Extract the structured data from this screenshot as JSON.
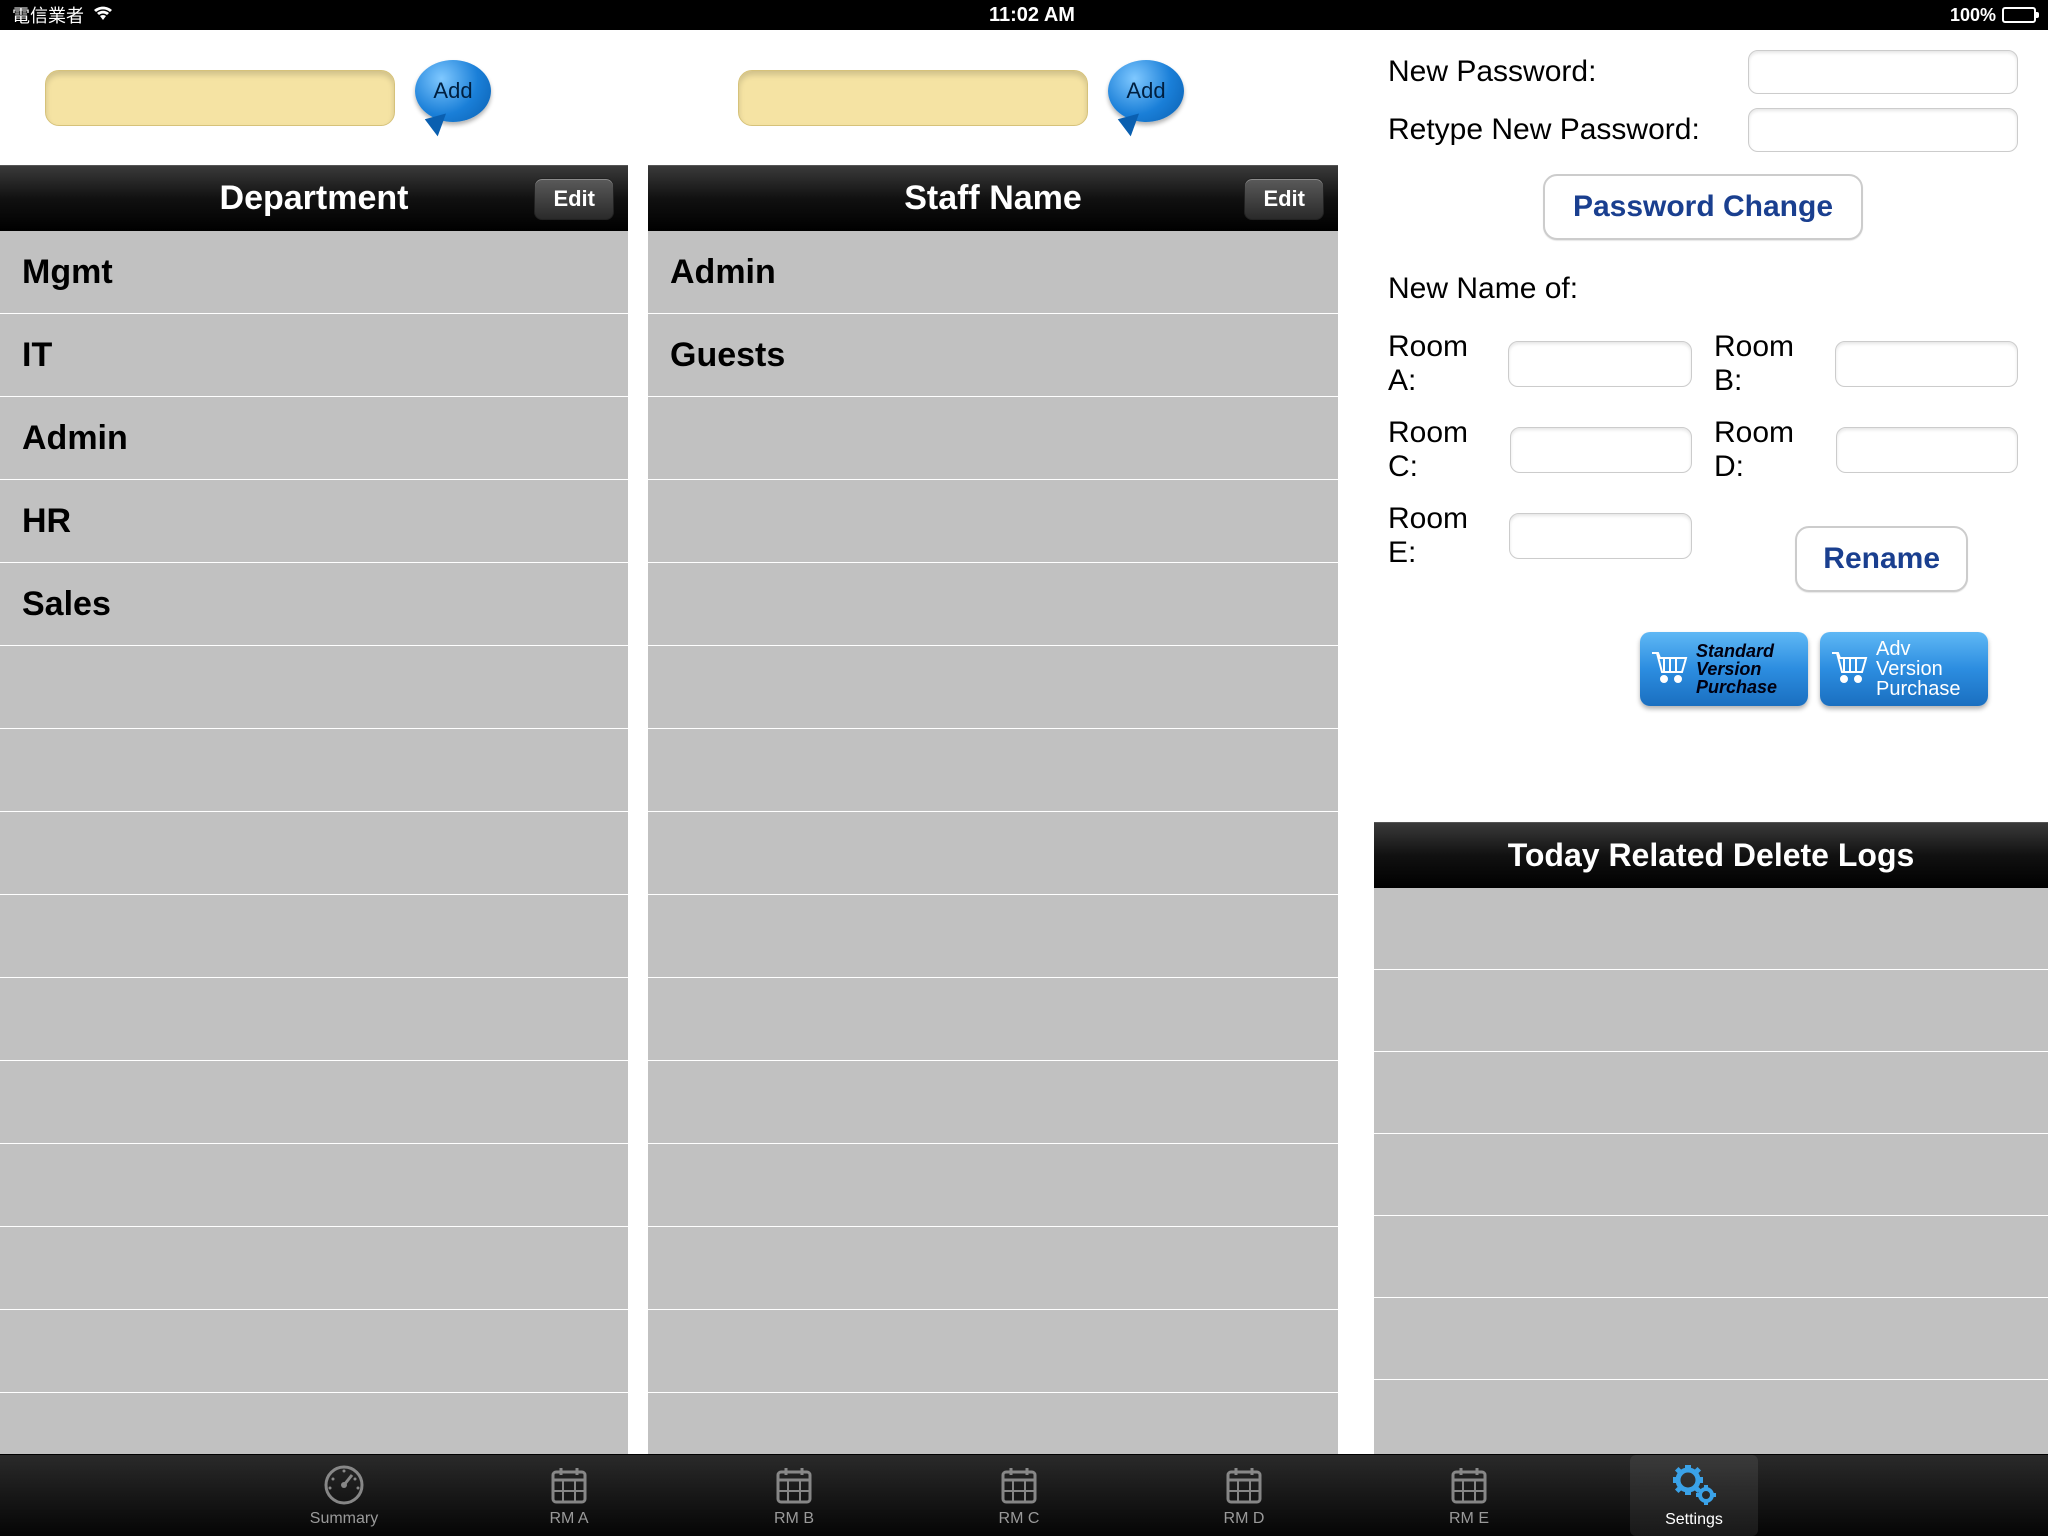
{
  "status": {
    "carrier": "電信業者",
    "time": "11:02 AM",
    "battery": "100%"
  },
  "add_label": "Add",
  "department": {
    "title": "Department",
    "edit": "Edit",
    "items": [
      "Mgmt",
      "IT",
      "Admin",
      "HR",
      "Sales"
    ]
  },
  "staff": {
    "title": "Staff Name",
    "edit": "Edit",
    "items": [
      "Admin",
      "Guests"
    ]
  },
  "password": {
    "new_label": "New Password:",
    "retype_label": "Retype New Password:",
    "button": "Password Change"
  },
  "rooms": {
    "heading": "New Name of:",
    "labels": {
      "a": "Room A:",
      "b": "Room B:",
      "c": "Room C:",
      "d": "Room D:",
      "e": "Room E:"
    },
    "rename": "Rename"
  },
  "purchase": {
    "standard": {
      "l1": "Standard",
      "l2": "Version",
      "l3": "Purchase"
    },
    "adv": {
      "l1": "Adv",
      "l2": "Version",
      "l3": "Purchase"
    }
  },
  "logs": {
    "title": "Today Related Delete Logs"
  },
  "tabs": {
    "summary": "Summary",
    "rma": "RM A",
    "rmb": "RM B",
    "rmc": "RM C",
    "rmd": "RM D",
    "rme": "RM E",
    "settings": "Settings"
  }
}
